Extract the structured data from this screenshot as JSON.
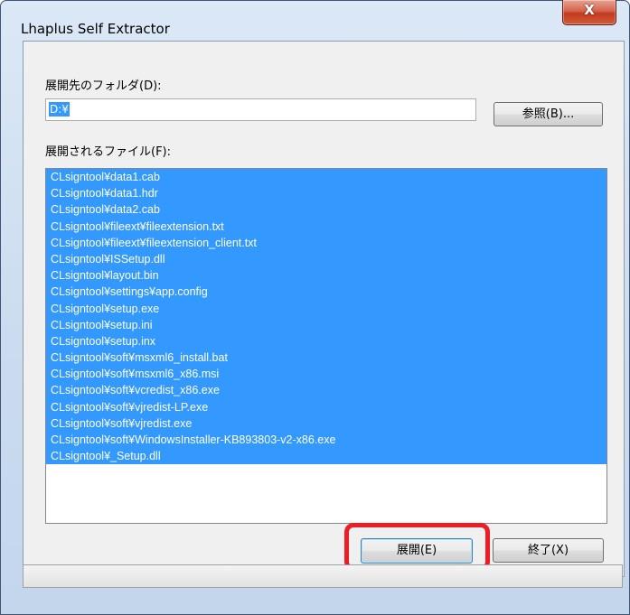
{
  "window": {
    "title": "Lhaplus Self Extractor",
    "close_label": "X"
  },
  "destination": {
    "label": "展開先のフォルダ(D):",
    "value": "D:¥",
    "browse_label": "参照(B)..."
  },
  "files": {
    "label": "展開されるファイル(F):",
    "items": [
      "CLsigntool¥data1.cab",
      "CLsigntool¥data1.hdr",
      "CLsigntool¥data2.cab",
      "CLsigntool¥fileext¥fileextension.txt",
      "CLsigntool¥fileext¥fileextension_client.txt",
      "CLsigntool¥ISSetup.dll",
      "CLsigntool¥layout.bin",
      "CLsigntool¥settings¥app.config",
      "CLsigntool¥setup.exe",
      "CLsigntool¥setup.ini",
      "CLsigntool¥setup.inx",
      "CLsigntool¥soft¥msxml6_install.bat",
      "CLsigntool¥soft¥msxml6_x86.msi",
      "CLsigntool¥soft¥vcredist_x86.exe",
      "CLsigntool¥soft¥vjredist-LP.exe",
      "CLsigntool¥soft¥vjredist.exe",
      "CLsigntool¥soft¥WindowsInstaller-KB893803-v2-x86.exe",
      "CLsigntool¥_Setup.dll"
    ]
  },
  "actions": {
    "extract_label": "展開(E)",
    "exit_label": "終了(X)"
  },
  "colors": {
    "selection": "#3399ff",
    "highlight": "#ee1c25",
    "close_button": "#c3391e"
  }
}
